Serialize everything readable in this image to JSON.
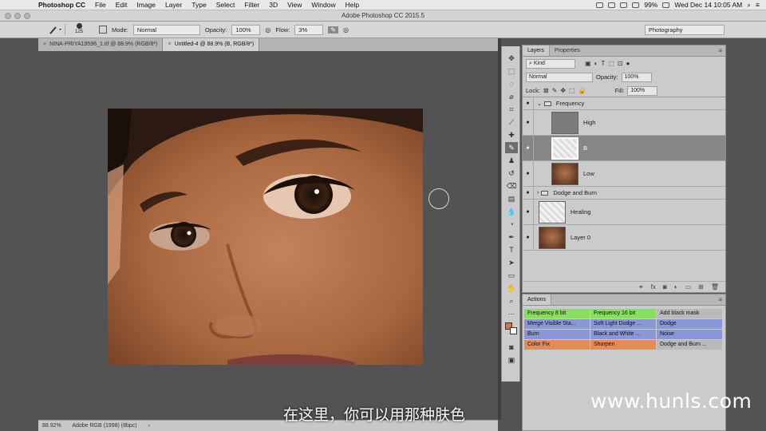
{
  "menubar": {
    "app_name": "Photoshop CC",
    "items": [
      "File",
      "Edit",
      "Image",
      "Layer",
      "Type",
      "Select",
      "Filter",
      "3D",
      "View",
      "Window",
      "Help"
    ],
    "battery": "99%",
    "clock": "Wed Dec 14  10:05 AM"
  },
  "window": {
    "title": "Adobe Photoshop CC 2015.5"
  },
  "options": {
    "brush_size": "125",
    "mode_label": "Mode:",
    "mode_value": "Normal",
    "opacity_label": "Opacity:",
    "opacity_value": "100%",
    "flow_label": "Flow:",
    "flow_value": "3%",
    "workspace": "Photography"
  },
  "tabs": [
    {
      "label": "NINA-PRIYA19596_1.tif @ 88.9% (RGB/8*)",
      "active": false
    },
    {
      "label": "Untitled-4 @ 88.9% (B, RGB/8*)",
      "active": true
    }
  ],
  "status": {
    "zoom": "88.92%",
    "profile": "Adobe RGB (1998) (8bpc)"
  },
  "layers_panel": {
    "tabs": [
      "Layers",
      "Properties"
    ],
    "filter_value": "Kind",
    "blend_mode": "Normal",
    "opacity_label": "Opacity:",
    "opacity_value": "100%",
    "lock_label": "Lock:",
    "fill_label": "Fill:",
    "fill_value": "100%",
    "layers": [
      {
        "name": "Frequency",
        "type": "group"
      },
      {
        "name": "High",
        "type": "layer"
      },
      {
        "name": "B",
        "type": "layer"
      },
      {
        "name": "Low",
        "type": "layer"
      },
      {
        "name": "Dodge and Burn",
        "type": "group"
      },
      {
        "name": "Healing",
        "type": "layer"
      },
      {
        "name": "Layer 0",
        "type": "layer"
      }
    ]
  },
  "actions_panel": {
    "title": "Actions",
    "actions": [
      {
        "label": "Frequency 8 bit",
        "color": "#86e05c"
      },
      {
        "label": "Frequency 16 bit",
        "color": "#86e05c"
      },
      {
        "label": "Add black mask",
        "color": "#b9b9b9"
      },
      {
        "label": "Merge Visible Sta...",
        "color": "#8996d8"
      },
      {
        "label": "Soft Light Dodge ...",
        "color": "#8996d8"
      },
      {
        "label": "Dodge",
        "color": "#8996d8"
      },
      {
        "label": "Burn",
        "color": "#8996d8"
      },
      {
        "label": "Black and White ...",
        "color": "#8996d8"
      },
      {
        "label": "Noise",
        "color": "#8996d8"
      },
      {
        "label": "Color Fix",
        "color": "#e88a55"
      },
      {
        "label": "Sharpen",
        "color": "#e88a55"
      },
      {
        "label": "Dodge and Burn ...",
        "color": "#b9b9b9"
      }
    ]
  },
  "subtitle": "在这里，你可以用那种肤色",
  "watermark": "www.hunls.com",
  "colors": {
    "foreground": "#c47a57",
    "background": "#ffffff"
  }
}
